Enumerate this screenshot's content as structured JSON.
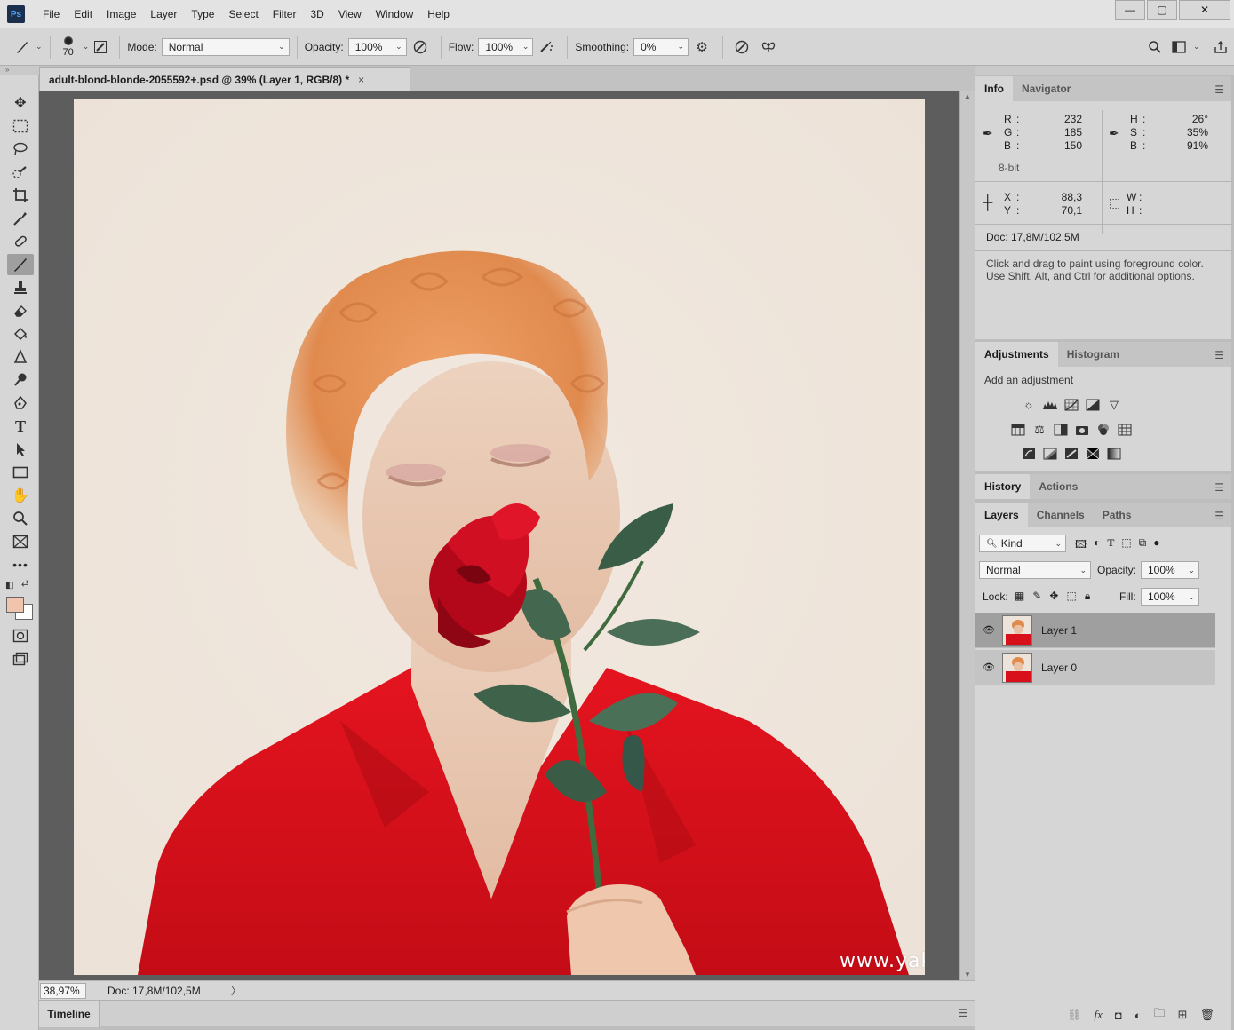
{
  "menu": {
    "logo": "Ps",
    "items": [
      "File",
      "Edit",
      "Image",
      "Layer",
      "Type",
      "Select",
      "Filter",
      "3D",
      "View",
      "Window",
      "Help"
    ],
    "window_controls": [
      "—",
      "▢",
      "✕"
    ]
  },
  "options": {
    "brush_size": "70",
    "mode_label": "Mode:",
    "mode_value": "Normal",
    "opacity_label": "Opacity:",
    "opacity_value": "100%",
    "flow_label": "Flow:",
    "flow_value": "100%",
    "smoothing_label": "Smoothing:",
    "smoothing_value": "0%"
  },
  "document": {
    "tab_title": "adult-blond-blonde-2055592+.psd @ 39% (Layer 1, RGB/8) *",
    "close": "×",
    "watermark": "www.yakymchuk.net"
  },
  "status": {
    "zoom": "38,97%",
    "doc_size": "Doc: 17,8M/102,5M",
    "arrow": "〉"
  },
  "timeline": {
    "label": "Timeline"
  },
  "info_panel": {
    "tabs": [
      "Info",
      "Navigator"
    ],
    "rgb": [
      {
        "key": "R",
        "val": "232"
      },
      {
        "key": "G",
        "val": "185"
      },
      {
        "key": "B",
        "val": "150"
      }
    ],
    "hsb": [
      {
        "key": "H",
        "val": "26°"
      },
      {
        "key": "S",
        "val": "35%"
      },
      {
        "key": "B",
        "val": "91%"
      }
    ],
    "bit_depth": "8-bit",
    "xy": [
      {
        "key": "X",
        "val": "88,3"
      },
      {
        "key": "Y",
        "val": "70,1"
      }
    ],
    "wh": [
      {
        "key": "W",
        "val": ""
      },
      {
        "key": "H",
        "val": ""
      }
    ],
    "doc_size": "Doc: 17,8M/102,5M",
    "hint_line1": "Click and drag to paint using foreground color.",
    "hint_line2": "Use Shift, Alt, and Ctrl for additional options."
  },
  "adjustments_panel": {
    "tabs": [
      "Adjustments",
      "Histogram"
    ],
    "title": "Add an adjustment"
  },
  "history_panel": {
    "tabs": [
      "History",
      "Actions"
    ]
  },
  "layers_panel": {
    "tabs": [
      "Layers",
      "Channels",
      "Paths"
    ],
    "filter_value": "Kind",
    "blend_mode": "Normal",
    "opacity_label": "Opacity:",
    "opacity_value": "100%",
    "lock_label": "Lock:",
    "fill_label": "Fill:",
    "fill_value": "100%",
    "layers": [
      {
        "name": "Layer 1",
        "selected": true
      },
      {
        "name": "Layer 0",
        "selected": false
      }
    ]
  },
  "colors": {
    "foreground": "#f1c4ad",
    "background": "#ffffff",
    "canvas_bg": "#efe6dd",
    "shirt": "#d8101c",
    "hair": "#e08a4e"
  }
}
